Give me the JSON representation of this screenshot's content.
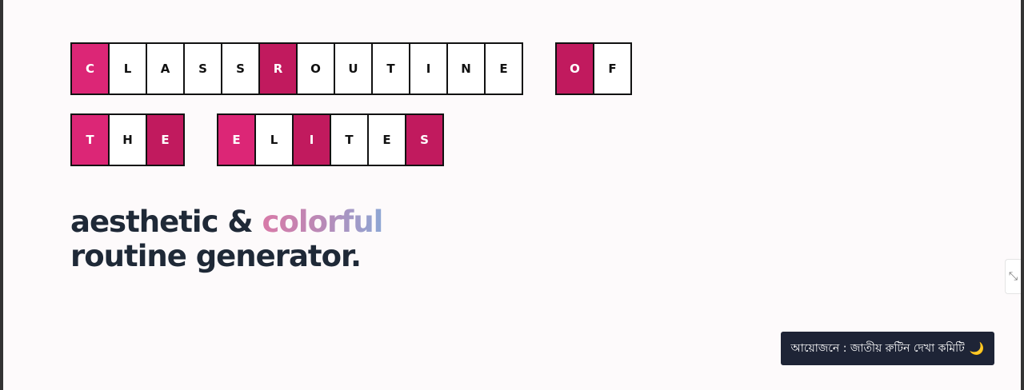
{
  "title": {
    "rows": [
      [
        [
          {
            "letter": "C",
            "style": "pink"
          },
          {
            "letter": "L",
            "style": "white"
          },
          {
            "letter": "A",
            "style": "white"
          },
          {
            "letter": "S",
            "style": "white"
          },
          {
            "letter": "S",
            "style": "white"
          },
          {
            "letter": "R",
            "style": "magenta"
          },
          {
            "letter": "O",
            "style": "white"
          },
          {
            "letter": "U",
            "style": "white"
          },
          {
            "letter": "T",
            "style": "white"
          },
          {
            "letter": "I",
            "style": "white"
          },
          {
            "letter": "N",
            "style": "white"
          },
          {
            "letter": "E",
            "style": "white"
          }
        ],
        [
          {
            "letter": "O",
            "style": "magenta"
          },
          {
            "letter": "F",
            "style": "white"
          }
        ]
      ],
      [
        [
          {
            "letter": "T",
            "style": "pink"
          },
          {
            "letter": "H",
            "style": "white"
          },
          {
            "letter": "E",
            "style": "magenta"
          }
        ],
        [
          {
            "letter": "E",
            "style": "pink"
          },
          {
            "letter": "L",
            "style": "white"
          },
          {
            "letter": "I",
            "style": "magenta"
          },
          {
            "letter": "T",
            "style": "white"
          },
          {
            "letter": "E",
            "style": "white"
          },
          {
            "letter": "S",
            "style": "magenta"
          }
        ]
      ]
    ]
  },
  "headline": {
    "line1_prefix": "aesthetic & ",
    "line1_highlight": "colorful",
    "line2": "routine generator."
  },
  "credit": {
    "text": "আয়োজনে : জাতীয় রুটিন দেখা কমিটি",
    "icon": "moon-icon",
    "glyph": "🌙"
  },
  "side_tab": {
    "icon": "collapse-icon",
    "glyph": "⤡"
  },
  "colors": {
    "pink": "#dc2676",
    "magenta": "#c11a5e",
    "text_dark": "#1f2937",
    "credit_bg": "#1e2436"
  }
}
